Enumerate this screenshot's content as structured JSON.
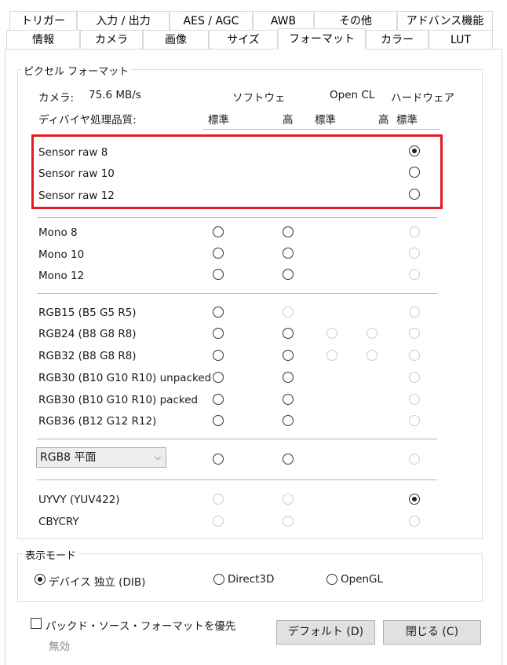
{
  "tabs_row1": [
    "トリガー",
    "入力 / 出力",
    "AES / AGC",
    "AWB",
    "その他",
    "アドバンス機能"
  ],
  "tabs_row2": [
    "情報",
    "カメラ",
    "画像",
    "サイズ",
    "フォーマット",
    "カラー",
    "LUT"
  ],
  "active_tab": "フォーマット",
  "pixel_format": {
    "legend": "ピクセル フォーマット",
    "camera_label": "カメラ:",
    "camera_rate": "75.6 MB/s",
    "col_software": "ソフトウェ",
    "col_opencl": "Open CL",
    "col_hardware": "ハードウェア",
    "quality_label": "ディバイヤ処理品質:",
    "q_standard1": "標準",
    "q_high1": "高",
    "q_standard2": "標準",
    "q_high2": "高",
    "q_standard3": "標準",
    "rows": {
      "sensor_raw_8": "Sensor raw 8",
      "sensor_raw_10": "Sensor raw 10",
      "sensor_raw_12": "Sensor raw 12",
      "mono_8": "Mono 8",
      "mono_10": "Mono 10",
      "mono_12": "Mono 12",
      "rgb15": "RGB15 (B5 G5 R5)",
      "rgb24": "RGB24 (B8 G8 R8)",
      "rgb32": "RGB32 (B8 G8 R8)",
      "rgb30_unpacked": "RGB30 (B10 G10 R10) unpacked",
      "rgb30_packed": "RGB30 (B10 G10 R10) packed",
      "rgb36": "RGB36 (B12 G12 R12)",
      "uyvy": "UYVY (YUV422)",
      "cbycry": "CBYCRY"
    },
    "planar_select": "RGB8 平面",
    "selected": "Sensor raw 8"
  },
  "display_mode": {
    "legend": "表示モード",
    "dib": "デバイス 独立 (DIB)",
    "direct3d": "Direct3D",
    "opengl": "OpenGL",
    "selected": "デバイス 独立 (DIB)"
  },
  "footer": {
    "prefer_packed": "パックド・ソース・フォーマットを優先",
    "disabled_note": "無効",
    "default_button": "デフォルト (D)",
    "close_button": "閉じる (C)"
  }
}
